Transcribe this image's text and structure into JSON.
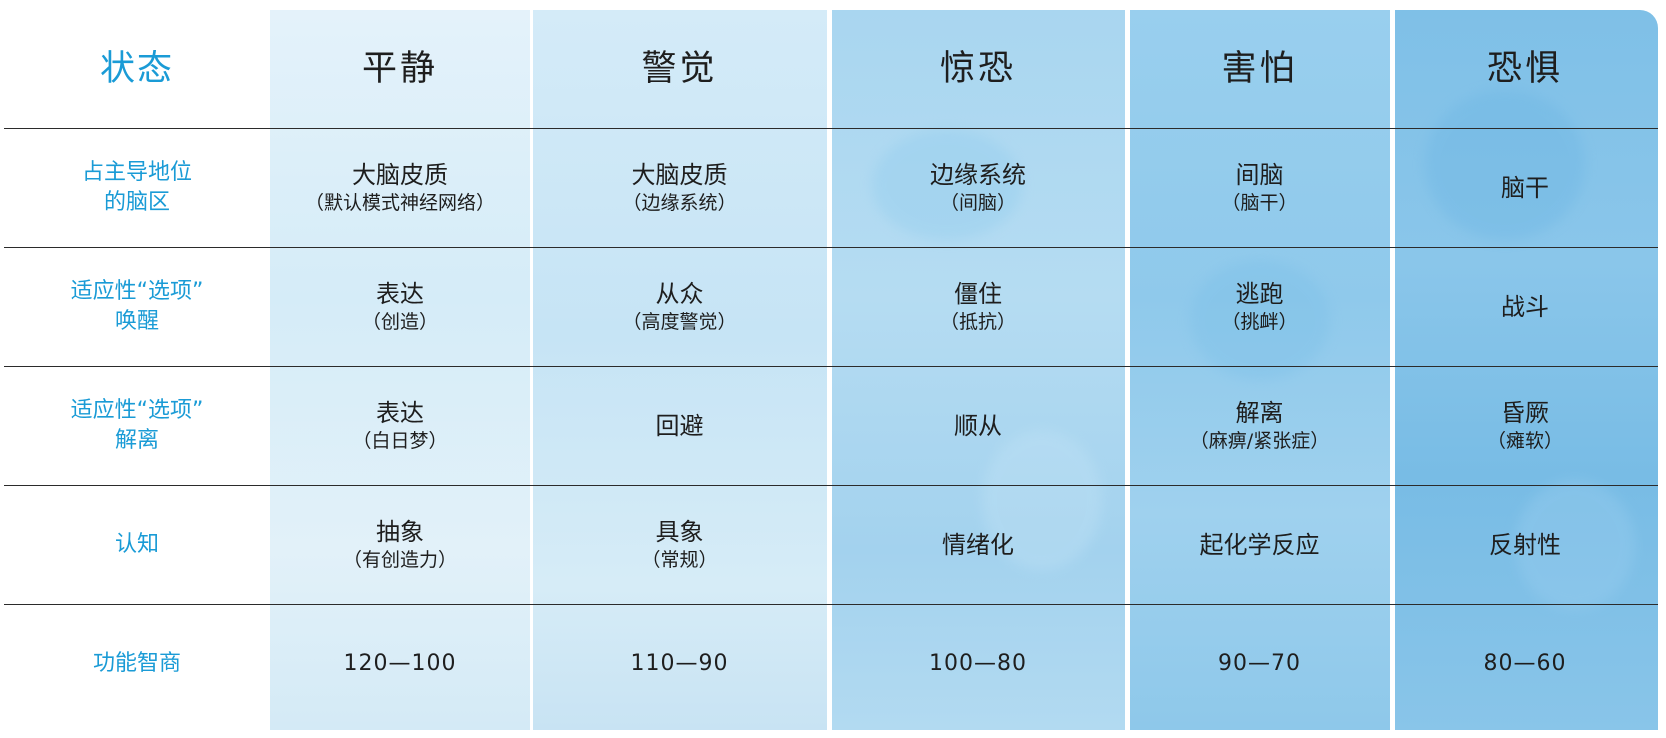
{
  "header": {
    "state_label": "状态",
    "columns": [
      "平静",
      "警觉",
      "惊恐",
      "害怕",
      "恐惧"
    ]
  },
  "rows": [
    {
      "label": [
        "占主导地位",
        "的脑区"
      ],
      "cells": [
        {
          "main": "大脑皮质",
          "sub": "（默认模式神经网络）"
        },
        {
          "main": "大脑皮质",
          "sub": "（边缘系统）"
        },
        {
          "main": "边缘系统",
          "sub": "（间脑）"
        },
        {
          "main": "间脑",
          "sub": "（脑干）"
        },
        {
          "main": "脑干",
          "sub": ""
        }
      ]
    },
    {
      "label": [
        "适应性“选项”",
        "唤醒"
      ],
      "cells": [
        {
          "main": "表达",
          "sub": "（创造）"
        },
        {
          "main": "从众",
          "sub": "（高度警觉）"
        },
        {
          "main": "僵住",
          "sub": "（抵抗）"
        },
        {
          "main": "逃跑",
          "sub": "（挑衅）"
        },
        {
          "main": "战斗",
          "sub": ""
        }
      ]
    },
    {
      "label": [
        "适应性“选项”",
        "解离"
      ],
      "cells": [
        {
          "main": "表达",
          "sub": "（白日梦）"
        },
        {
          "main": "回避",
          "sub": ""
        },
        {
          "main": "顺从",
          "sub": ""
        },
        {
          "main": "解离",
          "sub": "（麻痹/紧张症）"
        },
        {
          "main": "昏厥",
          "sub": "（瘫软）"
        }
      ]
    },
    {
      "label": [
        "认知",
        ""
      ],
      "cells": [
        {
          "main": "抽象",
          "sub": "（有创造力）"
        },
        {
          "main": "具象",
          "sub": "（常规）"
        },
        {
          "main": "情绪化",
          "sub": ""
        },
        {
          "main": "起化学反应",
          "sub": ""
        },
        {
          "main": "反射性",
          "sub": ""
        }
      ]
    },
    {
      "label": [
        "功能智商",
        ""
      ],
      "cells": [
        {
          "main": "120—100",
          "sub": ""
        },
        {
          "main": "110—90",
          "sub": ""
        },
        {
          "main": "100—80",
          "sub": ""
        },
        {
          "main": "90—70",
          "sub": ""
        },
        {
          "main": "80—60",
          "sub": ""
        }
      ]
    }
  ],
  "colors": {
    "accent": "#1a9bd6",
    "text": "#1e1e1e",
    "rule": "#2b2b2b"
  }
}
